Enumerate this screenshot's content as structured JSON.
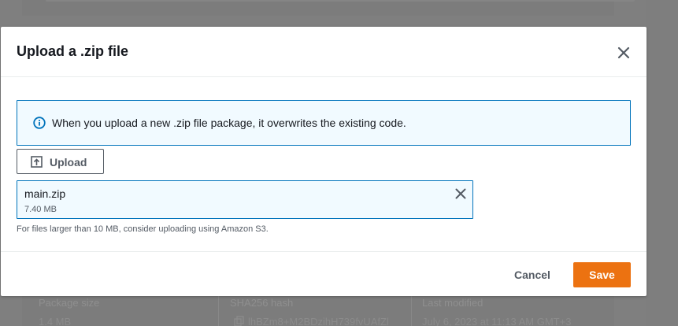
{
  "colors": {
    "accent": "#ec7211",
    "info_border": "#0073bb",
    "info_bg": "#f1faff",
    "text": "#16191f",
    "muted": "#545b64"
  },
  "background": {
    "columns": [
      {
        "label": "Package size",
        "value": "1.4 MB"
      },
      {
        "label": "SHA256 hash",
        "value": "lhBZm8+M2BDzihH739fvUAfZl"
      },
      {
        "label": "Last modified",
        "value": "July 6, 2023 at 11:13 AM GMT+3"
      }
    ]
  },
  "modal": {
    "title": "Upload a .zip file",
    "close_icon": "close-icon",
    "info": {
      "icon": "info-icon",
      "text": "When you upload a new .zip file package, it overwrites the existing code."
    },
    "upload_button": {
      "icon": "upload-icon",
      "label": "Upload"
    },
    "file": {
      "name": "main.zip",
      "size": "7.40 MB",
      "remove_icon": "close-icon"
    },
    "hint": "For files larger than 10 MB, consider uploading using Amazon S3.",
    "footer": {
      "cancel_label": "Cancel",
      "save_label": "Save"
    }
  }
}
